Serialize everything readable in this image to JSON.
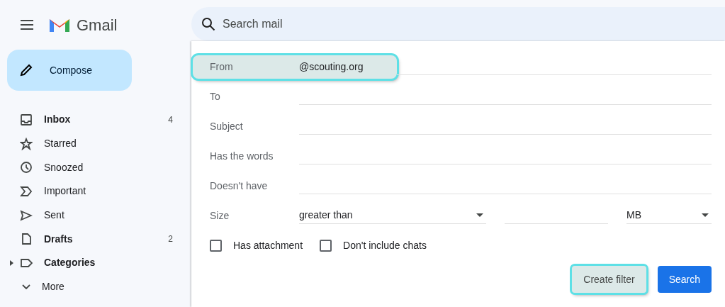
{
  "header": {
    "app_name": "Gmail"
  },
  "compose": {
    "label": "Compose"
  },
  "sidebar": {
    "items": [
      {
        "label": "Inbox",
        "count": "4",
        "unread": true,
        "kind": "folder"
      },
      {
        "label": "Starred",
        "unread": false,
        "kind": "folder"
      },
      {
        "label": "Snoozed",
        "unread": false,
        "kind": "folder"
      },
      {
        "label": "Important",
        "unread": false,
        "kind": "folder"
      },
      {
        "label": "Sent",
        "unread": false,
        "kind": "folder"
      },
      {
        "label": "Drafts",
        "count": "2",
        "unread": true,
        "kind": "folder"
      },
      {
        "label": "Categories",
        "unread": true,
        "kind": "group"
      },
      {
        "label": "More",
        "unread": false,
        "kind": "more"
      }
    ]
  },
  "search": {
    "placeholder": "Search mail"
  },
  "filter": {
    "fields": [
      {
        "label": "From",
        "value": "@scouting.org",
        "highlighted": true
      },
      {
        "label": "To",
        "highlighted": false
      },
      {
        "label": "Subject",
        "highlighted": false
      },
      {
        "label": "Has the words",
        "highlighted": false
      },
      {
        "label": "Doesn't have",
        "highlighted": false
      }
    ],
    "size": {
      "label": "Size",
      "operator": "greater than",
      "unit": "MB"
    },
    "checkboxes": [
      {
        "label": "Has attachment",
        "checked": false
      },
      {
        "label": "Don't include chats",
        "checked": false
      }
    ],
    "buttons": [
      {
        "label": "Create filter",
        "kind": "secondary",
        "highlighted": true
      },
      {
        "label": "Search",
        "kind": "primary",
        "highlighted": false
      }
    ]
  }
}
